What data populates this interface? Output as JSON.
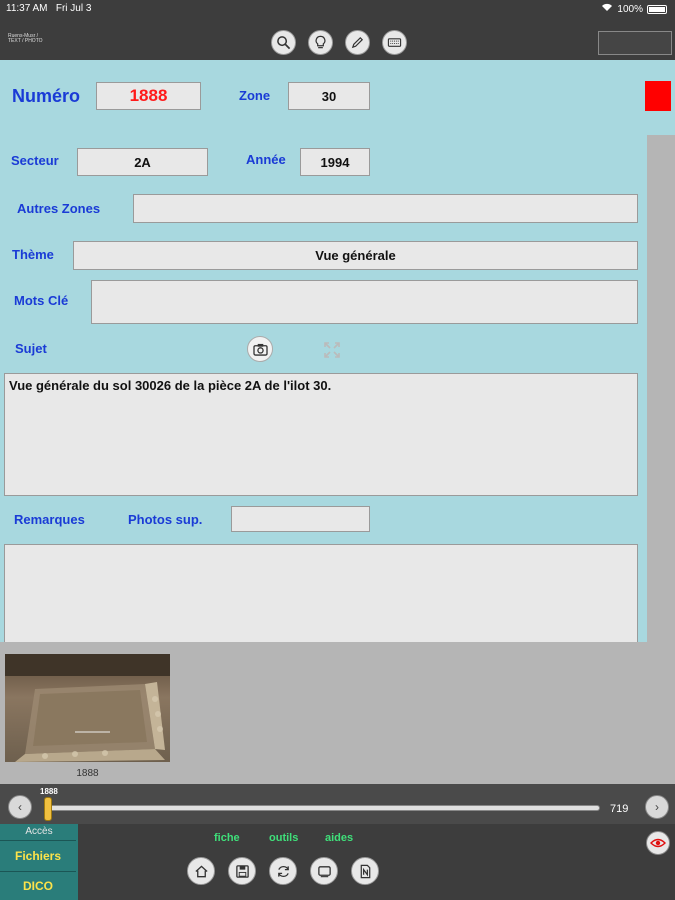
{
  "status": {
    "time": "11:37 AM",
    "date": "Fri Jul 3",
    "battery": "100%"
  },
  "app": {
    "path_line1": "Ruens-Musr /",
    "path_line2": "TEXT / PHOTO"
  },
  "form": {
    "numero_label": "Numéro",
    "numero_value": "1888",
    "zone_label": "Zone",
    "zone_value": "30",
    "secteur_label": "Secteur",
    "secteur_value": "2A",
    "annee_label": "Année",
    "annee_value": "1994",
    "autres_zones_label": "Autres Zones",
    "autres_zones_value": "",
    "theme_label": "Thème",
    "theme_value": "Vue générale",
    "mots_cle_label": "Mots Clé",
    "mots_cle_value": "",
    "sujet_label": "Sujet",
    "sujet_value": "Vue générale du sol 30026 de la pièce 2A de l'ilot 30.",
    "remarques_label": "Remarques",
    "photos_sup_label": "Photos sup.",
    "photos_sup_value": "",
    "remarques_value": ""
  },
  "thumbnail": {
    "caption": "1888"
  },
  "slider": {
    "min_label": "1888",
    "max_label": "719",
    "value_fraction": 0.0
  },
  "bottom": {
    "menu_title": "Accès",
    "menu_items": [
      "Fichiers",
      "DICO"
    ],
    "tabs": [
      "fiche",
      "outils",
      "aides"
    ]
  },
  "colors": {
    "accent_label": "#1a3bd6",
    "form_bg": "#a8d8df",
    "flag": "#ff0000",
    "tab_text": "#3fe07a",
    "menu_text": "#fde34a"
  }
}
